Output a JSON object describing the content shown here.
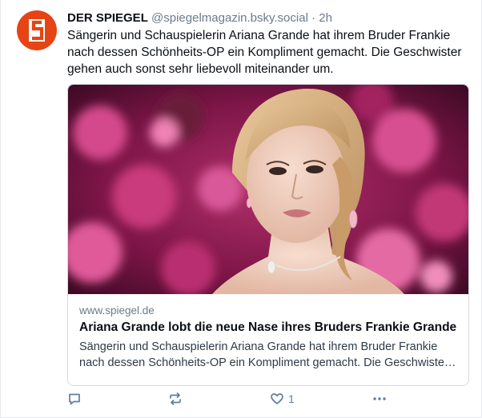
{
  "post": {
    "author": "DER SPIEGEL",
    "handle": "@spiegelmagazin.bsky.social",
    "separator": "·",
    "time": "2h",
    "text": "Sängerin und Schauspielerin Ariana Grande hat ihrem Bruder Frankie nach dessen Schönheits-OP ein Kompliment gemacht. Die Geschwister gehen auch sonst sehr liebevoll miteinander um.",
    "avatar_letter": "S"
  },
  "card": {
    "domain": "www.spiegel.de",
    "title": "Ariana Grande lobt die neue Nase ihres Bruders Frankie Grande",
    "description": "Sängerin und Schauspielerin Ariana Grande hat ihrem Bruder Frankie nach dessen Schönheits-OP ein Kompliment gemacht. Die Geschwister gehen auch sonst sehr liebevoll miteinander um."
  },
  "actions": {
    "reply_icon": "reply-icon",
    "repost_icon": "repost-icon",
    "like_icon": "heart-icon",
    "like_count": "1",
    "more_icon": "more-icon"
  },
  "colors": {
    "brand": "#e64415",
    "muted": "#6b7a8c",
    "background": "#ffffff"
  }
}
